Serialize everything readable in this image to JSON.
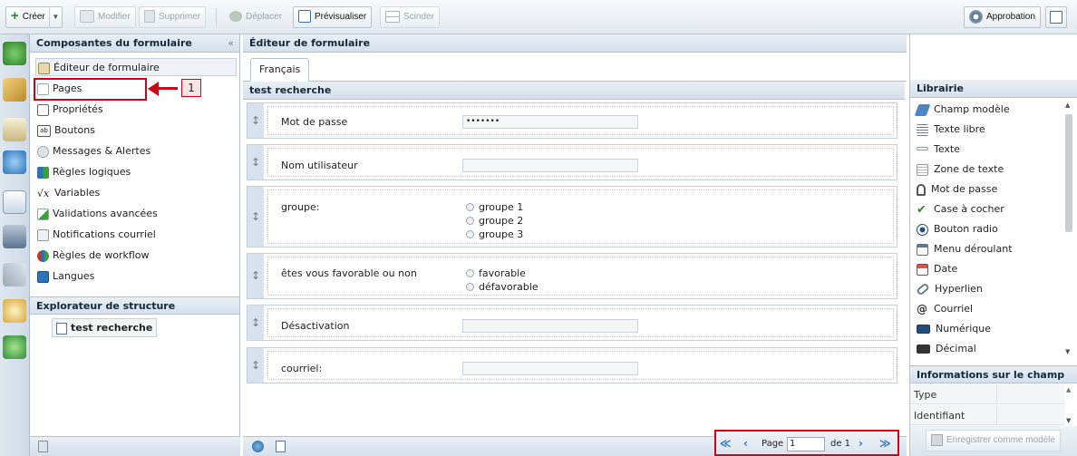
{
  "toolbar": {
    "create": "Créer",
    "modify": "Modifier",
    "delete": "Supprimer",
    "move": "Déplacer",
    "preview": "Prévisualiser",
    "split": "Scinder",
    "approval": "Approbation"
  },
  "left_panel": {
    "title": "Composantes du formulaire",
    "items": [
      {
        "label": "Éditeur de formulaire",
        "icon": "form-editor-icon"
      },
      {
        "label": "Pages",
        "icon": "page-icon"
      },
      {
        "label": "Propriétés",
        "icon": "properties-icon"
      },
      {
        "label": "Boutons",
        "icon": "buttons-icon"
      },
      {
        "label": "Messages & Alertes",
        "icon": "message-icon"
      },
      {
        "label": "Règles logiques",
        "icon": "logic-rules-icon"
      },
      {
        "label": "Variables",
        "icon": "variables-icon"
      },
      {
        "label": "Validations avancées",
        "icon": "validation-icon"
      },
      {
        "label": "Notifications courriel",
        "icon": "email-notification-icon"
      },
      {
        "label": "Règles de workflow",
        "icon": "workflow-icon"
      },
      {
        "label": "Langues",
        "icon": "language-icon"
      }
    ],
    "callout_number": "1",
    "explorer_title": "Explorateur de structure",
    "explorer_item": "test recherche"
  },
  "center": {
    "title": "Éditeur de formulaire",
    "tab": "Français",
    "form_title": "test recherche",
    "fields": [
      {
        "label": "Mot de passe",
        "value": "•••••••"
      },
      {
        "label": "Nom utilisateur",
        "value": ""
      },
      {
        "label": "groupe:",
        "options": [
          "groupe 1",
          "groupe 2",
          "groupe 3"
        ]
      },
      {
        "label": "êtes vous favorable ou non",
        "options": [
          "favorable",
          "défavorable"
        ]
      },
      {
        "label": "Désactivation",
        "value": ""
      },
      {
        "label": "courriel:",
        "value": ""
      }
    ],
    "pager": {
      "page_label": "Page",
      "page_value": "1",
      "of_label": "de 1"
    }
  },
  "library": {
    "title": "Librairie",
    "items": [
      {
        "label": "Champ modèle",
        "icon": "template-field-icon"
      },
      {
        "label": "Texte libre",
        "icon": "free-text-icon"
      },
      {
        "label": "Texte",
        "icon": "text-icon"
      },
      {
        "label": "Zone de texte",
        "icon": "textarea-icon"
      },
      {
        "label": "Mot de passe",
        "icon": "lock-icon"
      },
      {
        "label": "Case à cocher",
        "icon": "checkbox-icon"
      },
      {
        "label": "Bouton radio",
        "icon": "radio-icon"
      },
      {
        "label": "Menu déroulant",
        "icon": "dropdown-icon"
      },
      {
        "label": "Date",
        "icon": "calendar-icon"
      },
      {
        "label": "Hyperlien",
        "icon": "link-icon"
      },
      {
        "label": "Courriel",
        "icon": "at-icon"
      },
      {
        "label": "Numérique",
        "icon": "numeric-icon"
      },
      {
        "label": "Décimal",
        "icon": "decimal-icon"
      }
    ]
  },
  "field_info": {
    "title": "Informations sur le champ",
    "rows": [
      "Type",
      "Identifiant"
    ],
    "save_template": "Enregistrer comme modèle"
  },
  "colors": {
    "accent_red": "#d0021b",
    "header_blue": "#d6e0eb"
  }
}
